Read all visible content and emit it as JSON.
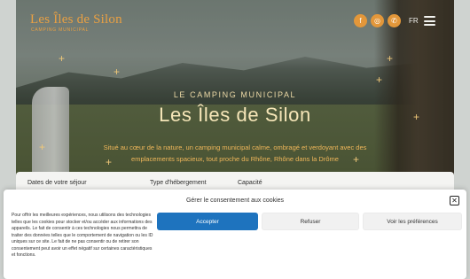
{
  "header": {
    "logo_text": "Les Îles de Silon",
    "logo_subtitle": "CAMPING MUNICIPAL",
    "icons": [
      "facebook-icon",
      "instagram-icon",
      "phone-icon"
    ],
    "language": "FR"
  },
  "hero": {
    "kicker": "LE CAMPING MUNICIPAL",
    "title": "Les Îles de Silon",
    "description": "Situé au cœur de la nature, un camping municipal calme, ombragé et verdoyant avec des emplacements spacieux, tout proche du Rhône, Rhône dans la Drôme"
  },
  "search": {
    "labels": [
      "Dates de votre séjour",
      "Type d'hébergement",
      "Capacité"
    ]
  },
  "cookie_banner": {
    "title": "Gérer le consentement aux cookies",
    "text": "Pour offrir les meilleures expériences, nous utilisons des technologies telles que les cookies pour stocker et/ou accéder aux informations des appareils. Le fait de consentir à ces technologies nous permettra de traiter des données telles que le comportement de navigation ou les ID uniques sur ce site. Le fait de ne pas consentir ou de retirer son consentement peut avoir un effet négatif sur certaines caractéristiques et fonctions.",
    "accept_label": "Accepter",
    "refuse_label": "Refuser",
    "prefs_label": "Voir les préférences",
    "close_symbol": "✕"
  },
  "colors": {
    "accent": "#e3973a",
    "primary_button": "#1e73be",
    "title": "#f6e6b8"
  }
}
